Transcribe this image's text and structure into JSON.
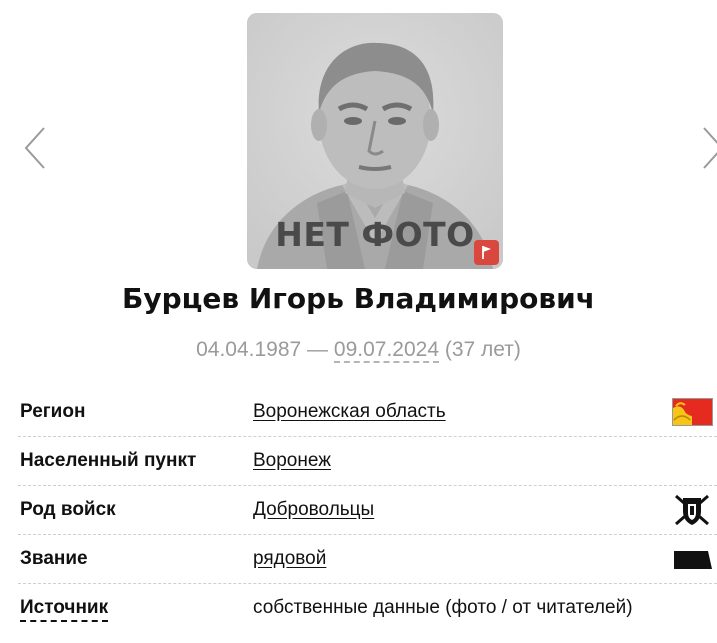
{
  "gallery": {
    "prev_icon": "chevron-left-icon",
    "next_icon": "chevron-right-icon",
    "no_photo_label": "НЕТ ФОТО",
    "report_icon": "flag-icon",
    "report_color": "#d9473f"
  },
  "person": {
    "name": "Бурцев Игорь Владимирович",
    "birth_date": "04.04.1987",
    "separator": " — ",
    "death_date": "09.07.2024",
    "age": " (37 лет)"
  },
  "details": {
    "region_label": "Регион",
    "region_value": "Воронежская область",
    "region_icon": "region-flag-icon",
    "settlement_label": "Населенный пункт",
    "settlement_value": "Воронеж",
    "troops_label": "Род войск",
    "troops_value": "Добровольцы",
    "troops_icon": "shield-emblem-icon",
    "rank_label": "Звание",
    "rank_value": "рядовой",
    "rank_icon": "rank-insignia-icon",
    "source_label": "Источник",
    "source_value": "собственные данные (фото / от читателей)"
  }
}
